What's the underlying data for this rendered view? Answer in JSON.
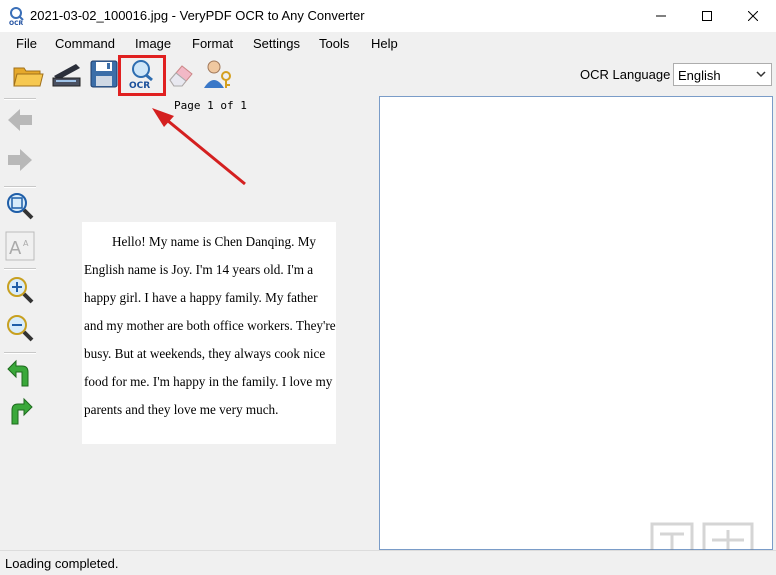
{
  "window": {
    "title": "2021-03-02_100016.jpg - VeryPDF OCR to Any Converter",
    "minimize_icon": "minimize-icon",
    "maximize_icon": "maximize-icon",
    "close_icon": "close-icon"
  },
  "menu": [
    "File",
    "Command",
    "Image",
    "Format",
    "Settings",
    "Tools",
    "Help"
  ],
  "toolbar": {
    "icons": [
      "open-folder-icon",
      "scanner-icon",
      "save-disk-icon",
      "ocr-magnifier-icon",
      "eraser-icon",
      "user-key-icon"
    ],
    "spellcheck_icon": "abc-spellcheck-icon",
    "ocr_language_label": "OCR Language",
    "ocr_language_value": "English"
  },
  "left_toolbar": {
    "icons": [
      "back-arrow-icon",
      "forward-arrow-icon",
      "zoom-fit-icon",
      "font-size-icon",
      "zoom-in-icon",
      "zoom-out-icon",
      "rotate-left-icon",
      "rotate-right-icon"
    ]
  },
  "page_indicator": "Page 1 of 1",
  "document_text": "Hello! My name is Chen Danqing. My English name is Joy. I'm 14 years old. I'm a happy girl. I have a happy family. My father and my mother are both office workers. They're busy. But at weekends, they always cook nice food for me. I'm happy in the family. I love my parents and they love me very much.",
  "status": "Loading completed.",
  "colors": {
    "highlight": "#e02020",
    "accent_blue": "#1a5fb4"
  }
}
